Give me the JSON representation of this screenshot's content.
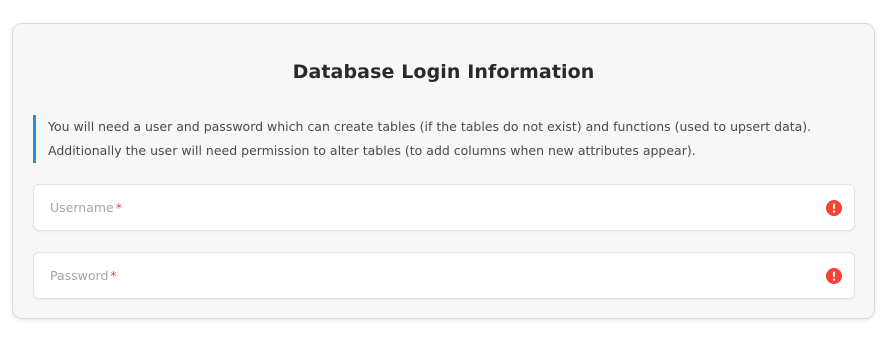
{
  "form": {
    "title": "Database Login Information",
    "info_line1": "You will need a user and password which can create tables (if the tables do not exist) and functions (used to upsert data).",
    "info_line2": "Additionally the user will need permission to alter tables (to add columns when new attributes appear).",
    "username": {
      "label": "Username",
      "required_mark": "*",
      "value": ""
    },
    "password": {
      "label": "Password",
      "required_mark": "*",
      "value": ""
    }
  },
  "colors": {
    "info_border": "#2a8fd6",
    "error": "#f44336",
    "required": "#e74c3c"
  },
  "icons": {
    "field_error": "alert-circle-icon"
  }
}
